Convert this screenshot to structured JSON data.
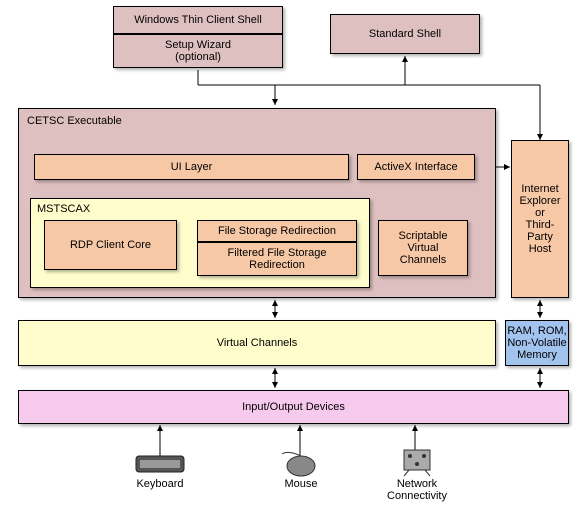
{
  "top": {
    "wtcs": "Windows Thin Client Shell",
    "setup": "Setup Wizard\n(optional)",
    "standard": "Standard Shell"
  },
  "cetsc": {
    "title": "CETSC Executable",
    "ui_layer": "UI Layer",
    "activex": "ActiveX Interface",
    "mstscax_title": "MSTSCAX",
    "rdp_core": "RDP Client Core",
    "file_redir": "File Storage Redirection",
    "filtered_redir": "Filtered File Storage\nRedirection",
    "scriptable": "Scriptable\nVirtual\nChannels"
  },
  "right": {
    "ie": "Internet\nExplorer\nor\nThird-\nParty\nHost",
    "ram": "RAM, ROM,\nNon-Volatile\nMemory"
  },
  "virtual_channels": "Virtual Channels",
  "io_devices": "Input/Output Devices",
  "devices": {
    "keyboard": "Keyboard",
    "mouse": "Mouse",
    "network": "Network\nConnectivity"
  }
}
